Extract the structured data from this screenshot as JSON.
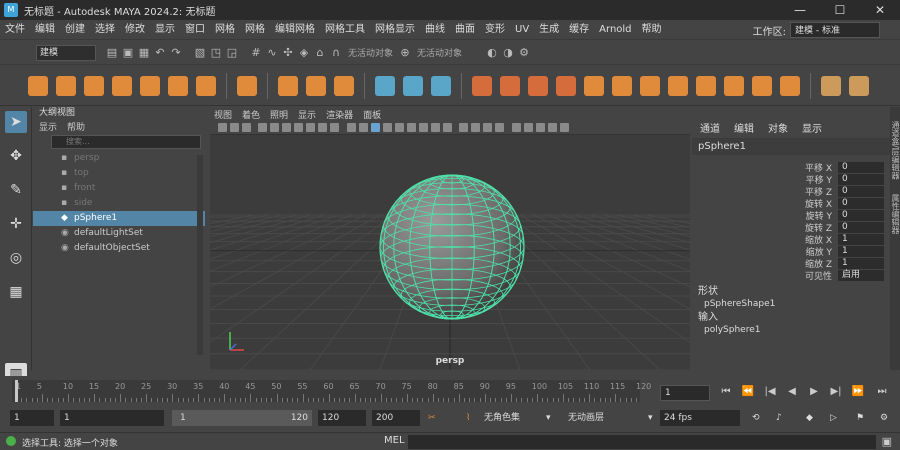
{
  "window": {
    "title": "无标题 - Autodesk MAYA 2024.2: 无标题",
    "controls": [
      "—",
      "☐",
      "✕"
    ]
  },
  "menu": {
    "items": [
      "文件",
      "编辑",
      "创建",
      "选择",
      "修改",
      "显示",
      "窗口",
      "网格",
      "网格",
      "编辑网格",
      "网格工具",
      "网格显示",
      "曲线",
      "曲面",
      "变形",
      "UV",
      "生成",
      "缓存",
      "Arnold",
      "帮助"
    ],
    "workspace_label": "工作区:",
    "workspace_value": "建模 - 标准"
  },
  "statusline": {
    "mode": "建模",
    "snap_text": "无活动对象",
    "sym_text": "无活动对象"
  },
  "outliner": {
    "header": "大纲视图",
    "tabs": [
      "显示",
      "帮助"
    ],
    "search_placeholder": "搜索...",
    "items": [
      {
        "label": "persp",
        "state": "dim",
        "icon": "camera-icon"
      },
      {
        "label": "top",
        "state": "dim",
        "icon": "camera-icon"
      },
      {
        "label": "front",
        "state": "dim",
        "icon": "camera-icon"
      },
      {
        "label": "side",
        "state": "dim",
        "icon": "camera-icon"
      },
      {
        "label": "pSphere1",
        "state": "selected",
        "icon": "mesh-icon"
      },
      {
        "label": "defaultLightSet",
        "state": "normal",
        "icon": "set-icon"
      },
      {
        "label": "defaultObjectSet",
        "state": "normal",
        "icon": "set-icon"
      }
    ]
  },
  "viewport": {
    "menus": [
      "视图",
      "着色",
      "照明",
      "显示",
      "渲染器",
      "面板"
    ],
    "camera": "persp",
    "mesh_color": "#4fe0a8"
  },
  "attribute_editor": {
    "tabs": [
      "通道",
      "编辑",
      "对象",
      "显示"
    ],
    "object": "pSphere1",
    "channels": [
      {
        "name": "平移 X",
        "value": "0"
      },
      {
        "name": "平移 Y",
        "value": "0"
      },
      {
        "name": "平移 Z",
        "value": "0"
      },
      {
        "name": "旋转 X",
        "value": "0"
      },
      {
        "name": "旋转 Y",
        "value": "0"
      },
      {
        "name": "旋转 Z",
        "value": "0"
      },
      {
        "name": "缩放 X",
        "value": "1"
      },
      {
        "name": "缩放 Y",
        "value": "1"
      },
      {
        "name": "缩放 Z",
        "value": "1"
      },
      {
        "name": "可见性",
        "value": "启用"
      }
    ],
    "shapes_label": "形状",
    "shape": "pSphereShape1",
    "inputs_label": "输入",
    "input": "polySphere1",
    "side_tabs": [
      "通道盒/层编辑器",
      "属性编辑器"
    ]
  },
  "timeline": {
    "ticks": [
      "1",
      "5",
      "10",
      "15",
      "20",
      "25",
      "30",
      "35",
      "40",
      "45",
      "50",
      "55",
      "60",
      "65",
      "70",
      "75",
      "80",
      "85",
      "90",
      "95",
      "100",
      "105",
      "110",
      "115",
      "120"
    ],
    "current_frame": "1",
    "playback": [
      "⏮",
      "⏪",
      "|◀",
      "◀",
      "▶",
      "▶|",
      "⏩",
      "⏭"
    ]
  },
  "range": {
    "start": "1",
    "range_start": "1",
    "slider_min": "1",
    "slider_max": "120",
    "range_end": "120",
    "end": "200",
    "char_set": "无角色集",
    "anim_layer": "无动画层",
    "fps": "24 fps"
  },
  "command": {
    "message": "选择工具: 选择一个对象",
    "lang": "MEL"
  }
}
